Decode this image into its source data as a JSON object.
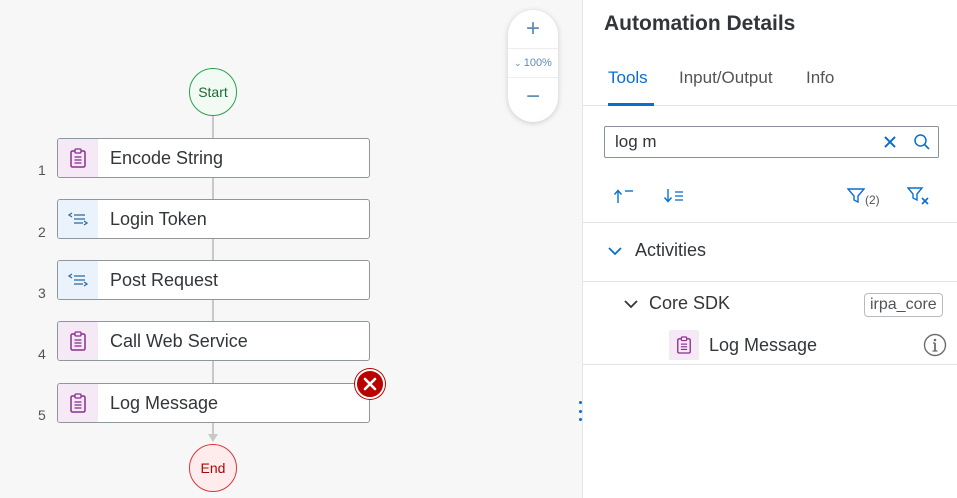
{
  "canvas": {
    "start_label": "Start",
    "end_label": "End",
    "steps": [
      {
        "number": "1",
        "label": "Encode String",
        "icon": "clipboard-icon",
        "color": "purple"
      },
      {
        "number": "2",
        "label": "Login Token",
        "icon": "token-list-icon",
        "color": "blue"
      },
      {
        "number": "3",
        "label": "Post Request",
        "icon": "token-list-icon",
        "color": "blue"
      },
      {
        "number": "4",
        "label": "Call Web Service",
        "icon": "clipboard-icon",
        "color": "purple"
      },
      {
        "number": "5",
        "label": "Log Message",
        "icon": "clipboard-icon",
        "color": "purple"
      }
    ],
    "zoom": {
      "plus": "+",
      "minus": "−",
      "level": "100%"
    }
  },
  "panel": {
    "title": "Automation Details",
    "tabs": [
      {
        "label": "Tools",
        "active": true
      },
      {
        "label": "Input/Output",
        "active": false
      },
      {
        "label": "Info",
        "active": false
      }
    ],
    "search": {
      "value": "log m"
    },
    "filter_count": "(2)",
    "tree": {
      "group_label": "Activities",
      "sdk_label": "Core SDK",
      "sdk_tag": "irpa_core",
      "item_label": "Log Message"
    }
  },
  "colors": {
    "accent": "#0a6ed1",
    "start": "#2e9e4f",
    "end": "#d9363e",
    "error": "#bb0000",
    "purple_icon": "#8b2f8f",
    "blue_icon": "#2f6ea8"
  }
}
